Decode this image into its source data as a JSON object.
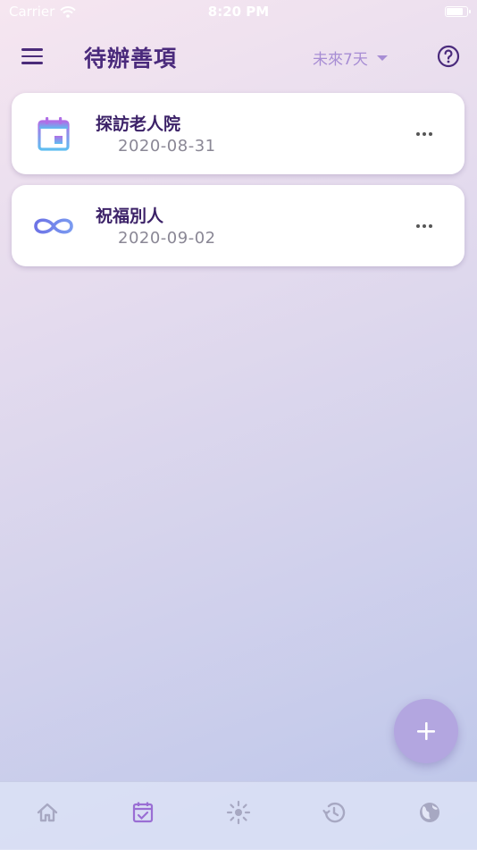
{
  "status_bar": {
    "carrier": "Carrier",
    "time": "8:20 PM"
  },
  "header": {
    "title": "待辦善項",
    "range": "未來7天",
    "menu_icon": "hamburger-menu-icon",
    "help_icon": "question-circle-icon"
  },
  "tasks": [
    {
      "title": "探訪老人院",
      "date": "2020-08-31",
      "icon": "calendar-icon"
    },
    {
      "title": "祝福別人",
      "date": "2020-09-02",
      "icon": "infinity-icon"
    }
  ],
  "fab": {
    "icon": "plus-icon"
  },
  "tabs": [
    {
      "icon": "home-icon",
      "active": false
    },
    {
      "icon": "calendar-check-icon",
      "active": true
    },
    {
      "icon": "sun-icon",
      "active": false
    },
    {
      "icon": "history-icon",
      "active": false
    },
    {
      "icon": "globe-icon",
      "active": false
    }
  ],
  "colors": {
    "primary": "#4a2a7c",
    "accent": "#a78dd4",
    "fab": "#b3a6e0",
    "inactive_tab": "#a7a8c2",
    "active_tab": "#9a6ed4"
  }
}
